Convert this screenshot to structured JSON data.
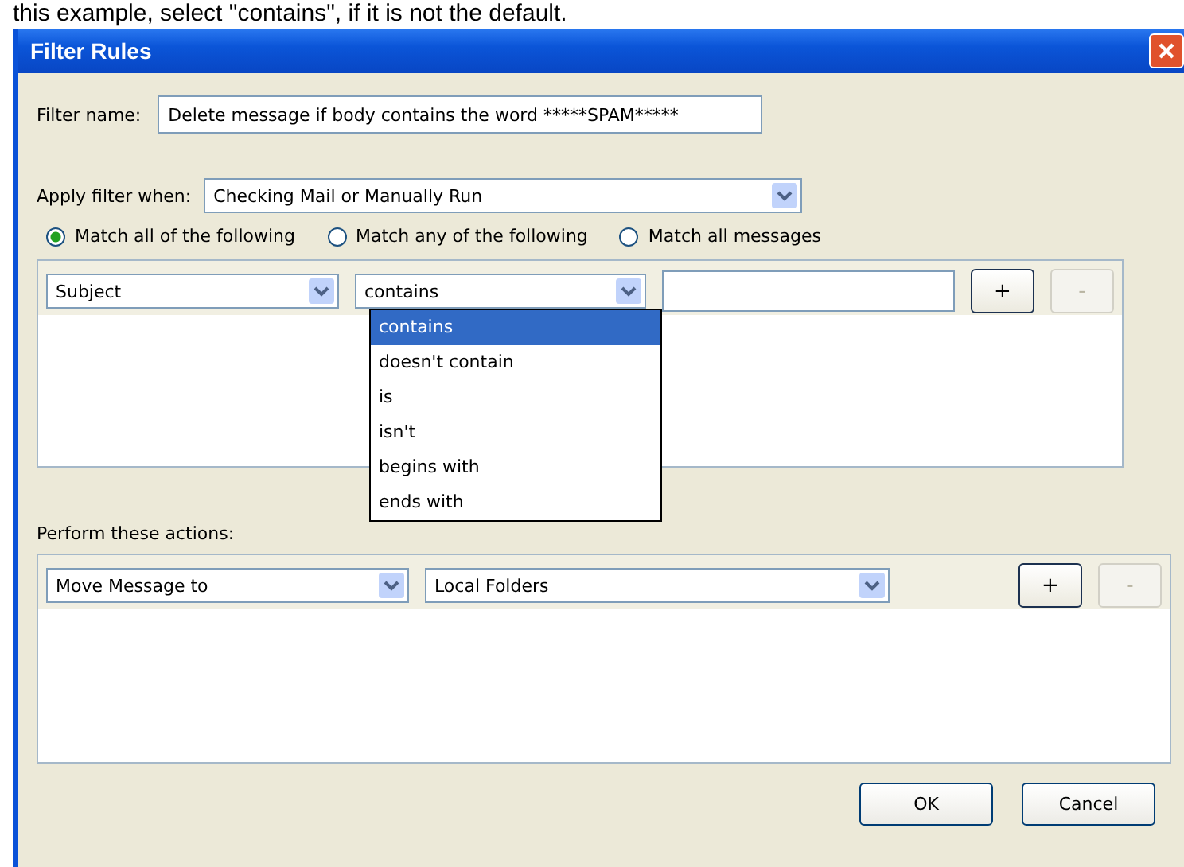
{
  "caption": "this example, select \"contains\", if it is not the default.",
  "window": {
    "title": "Filter Rules"
  },
  "filter_name": {
    "label": "Filter name:",
    "value": "Delete message if body contains the word *****SPAM*****"
  },
  "apply_when": {
    "label": "Apply filter when:",
    "value": "Checking Mail or Manually Run"
  },
  "match_options": [
    {
      "label": "Match all of the following",
      "selected": true
    },
    {
      "label": "Match any of the following",
      "selected": false
    },
    {
      "label": "Match all messages",
      "selected": false
    }
  ],
  "condition": {
    "field": "Subject",
    "operator": "contains",
    "add": "+",
    "remove": "-",
    "remove_disabled": true
  },
  "operator_menu": [
    {
      "label": "contains",
      "selected": true
    },
    {
      "label": "doesn't contain",
      "selected": false
    },
    {
      "label": "is",
      "selected": false
    },
    {
      "label": "isn't",
      "selected": false
    },
    {
      "label": "begins with",
      "selected": false
    },
    {
      "label": "ends with",
      "selected": false
    }
  ],
  "actions": {
    "label": "Perform these actions:",
    "action": "Move Message to",
    "target": "Local Folders",
    "add": "+",
    "remove": "-",
    "remove_disabled": true
  },
  "buttons": [
    "OK",
    "Cancel"
  ]
}
